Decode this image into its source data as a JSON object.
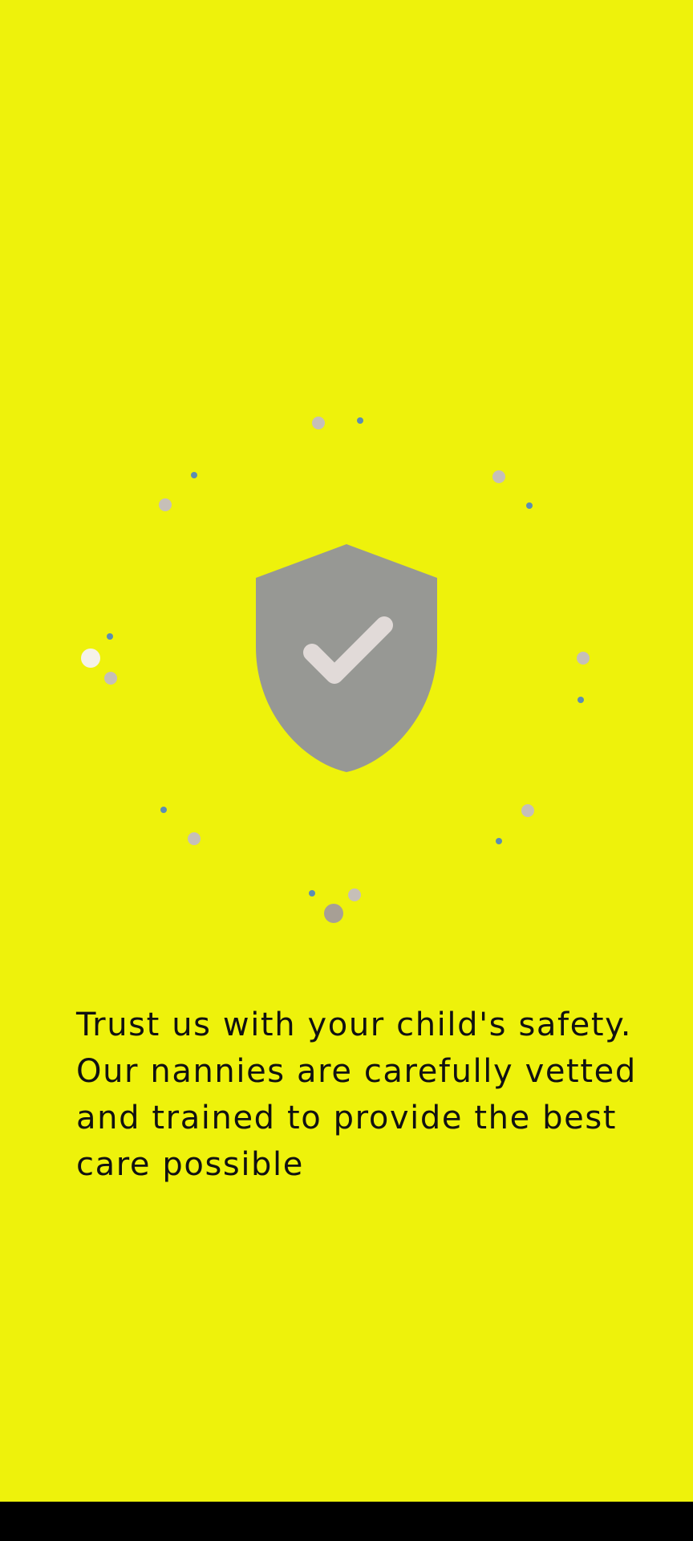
{
  "onboarding": {
    "message": "Trust us with your child's safety. Our nannies are carefully vetted and trained to provide the best care possible",
    "illustration": {
      "icon": "shield-check-icon",
      "colors": {
        "background": "#EEF20B",
        "shield": "#979894",
        "check": "#E1DAD8",
        "dot_gray": "#C6BFB8",
        "dot_blue": "#5C8DB3",
        "dot_light": "#F5F2E8",
        "dot_dark": "#A79F95"
      }
    }
  },
  "system": {
    "navigation_bar_color": "#000000"
  }
}
